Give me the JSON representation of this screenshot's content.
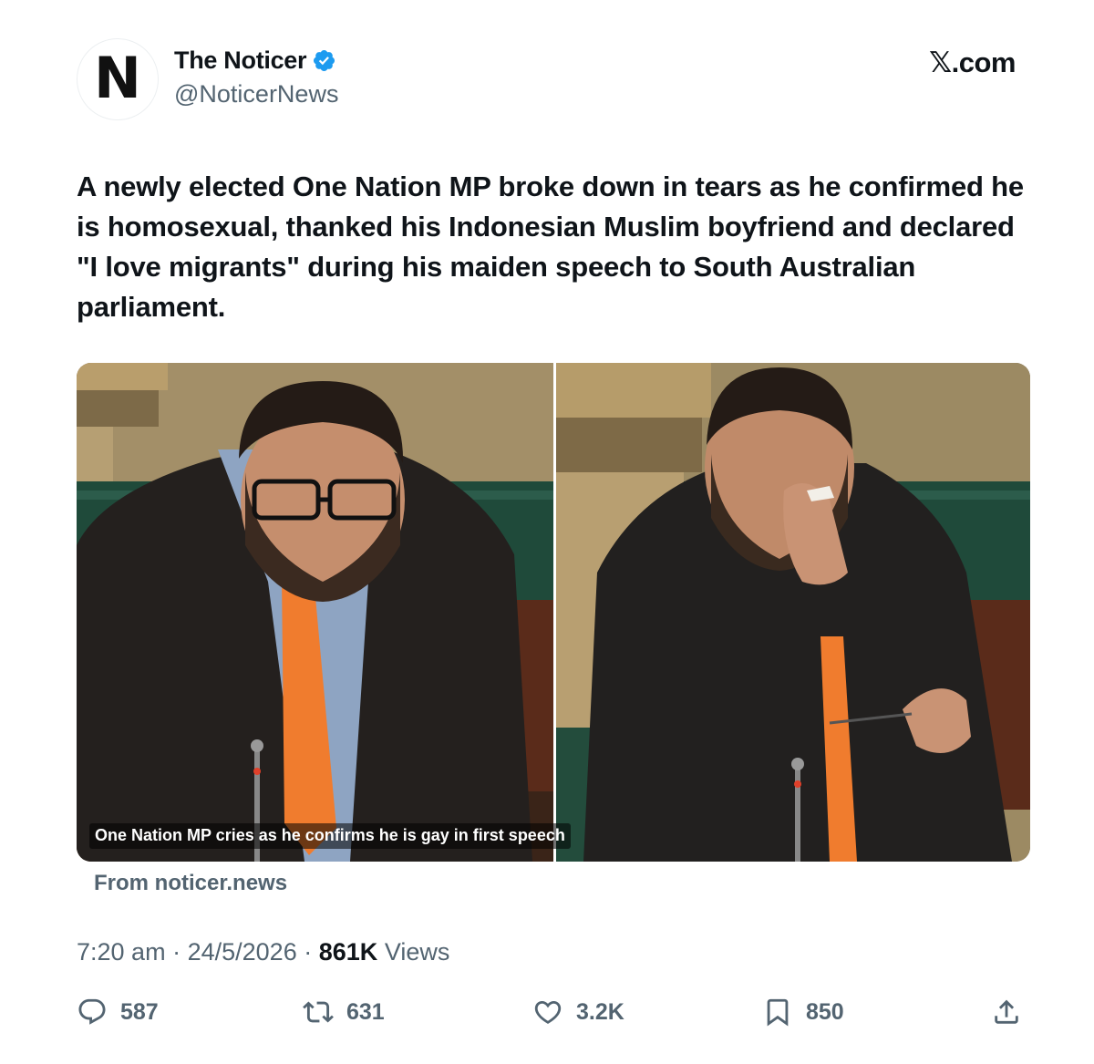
{
  "author": {
    "avatar_letter": "N",
    "display_name": "The Noticer",
    "handle": "@NoticerNews",
    "verified": true,
    "verified_color": "#1d9bf0"
  },
  "brand": "𝕏.com",
  "tweet": {
    "text": "A newly elected One Nation MP broke down in tears as he confirmed he is homosexual, thanked his Indonesian Muslim boyfriend and declared \"I love migrants\" during his maiden speech to South Australian parliament."
  },
  "media": {
    "caption": "One Nation MP cries as he confirms he is gay in first speech",
    "source": "From noticer.news"
  },
  "meta": {
    "time": "7:20 am",
    "date": "24/5/2026",
    "views_count": "861K",
    "views_label": "Views",
    "separator": "·"
  },
  "actions": {
    "replies": "587",
    "reposts": "631",
    "likes": "3.2K",
    "bookmarks": "850"
  },
  "icons": [
    "verified-badge-icon",
    "reply-icon",
    "repost-icon",
    "like-icon",
    "bookmark-icon",
    "share-icon"
  ],
  "colors": {
    "text": "#0f1419",
    "secondary": "#536471",
    "tie": "#f07c2e"
  }
}
